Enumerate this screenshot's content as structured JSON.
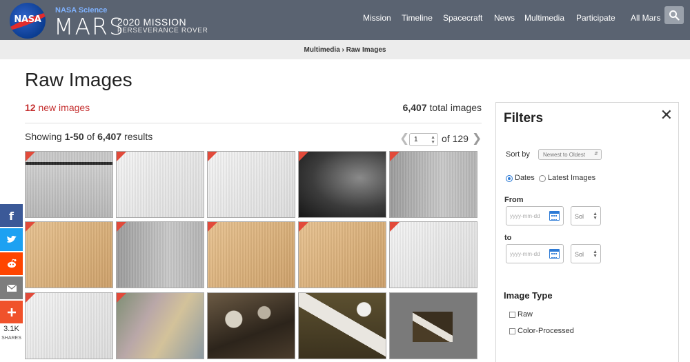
{
  "header": {
    "logo_text": "NASA",
    "subtitle": "NASA Science",
    "site_name": "MARS",
    "mission_line1": "2020 MISSION",
    "mission_line2": "PERSEVERANCE ROVER",
    "nav": [
      "Mission",
      "Timeline",
      "Spacecraft",
      "News",
      "Multimedia",
      "Participate",
      "All Mars"
    ]
  },
  "breadcrumb": "Multimedia › Raw Images",
  "page": {
    "title": "Raw Images",
    "new_count": "12",
    "new_label": "new images",
    "total_count": "6,407",
    "total_label": "total images",
    "showing_prefix": "Showing",
    "showing_range": "1-50",
    "showing_of": "of",
    "showing_total": "6,407",
    "showing_suffix": "results"
  },
  "pager": {
    "current_page": "1",
    "of_label": "of 129",
    "prev_icon": "chevron-left-icon",
    "next_icon": "chevron-right-icon"
  },
  "grid": {
    "tiles": [
      {
        "tone": "gray-band",
        "new": true
      },
      {
        "tone": "light",
        "new": true
      },
      {
        "tone": "light",
        "new": true
      },
      {
        "tone": "dark-vignette",
        "new": true
      },
      {
        "tone": "gray",
        "new": true
      },
      {
        "tone": "tan",
        "new": true
      },
      {
        "tone": "gray",
        "new": true
      },
      {
        "tone": "tan",
        "new": true
      },
      {
        "tone": "tan",
        "new": true
      },
      {
        "tone": "light",
        "new": true
      },
      {
        "tone": "light",
        "new": true
      },
      {
        "tone": "color-noise",
        "new": true
      },
      {
        "tone": "rover-arm-dark",
        "new": false
      },
      {
        "tone": "rover-arm-olive",
        "new": false
      },
      {
        "tone": "thumbnail-on-gray",
        "new": false
      }
    ]
  },
  "social": {
    "buttons": [
      {
        "icon": "facebook-icon",
        "color": "#3b5998"
      },
      {
        "icon": "twitter-icon",
        "color": "#1da1f2"
      },
      {
        "icon": "reddit-icon",
        "color": "#ff4500"
      },
      {
        "icon": "email-icon",
        "color": "#7d7d7d"
      },
      {
        "icon": "plus-icon",
        "color": "#f0522b"
      }
    ],
    "count": "3.1K",
    "count_label": "SHARES"
  },
  "filters": {
    "title": "Filters",
    "close_icon": "close-icon",
    "sort_label": "Sort by",
    "sort_value": "Newest to Oldest",
    "mode_options": [
      "Dates",
      "Latest Images"
    ],
    "mode_selected": "Dates",
    "from_label": "From",
    "to_label": "to",
    "date_placeholder": "yyyy-mm-dd",
    "sol_placeholder": "Sol",
    "image_type_title": "Image Type",
    "image_types": [
      "Raw",
      "Color-Processed"
    ]
  },
  "colors": {
    "header_bg": "#5a6371",
    "accent_red": "#c53030",
    "corner_red": "#e24a3a",
    "radio_blue": "#2d7bd6"
  }
}
